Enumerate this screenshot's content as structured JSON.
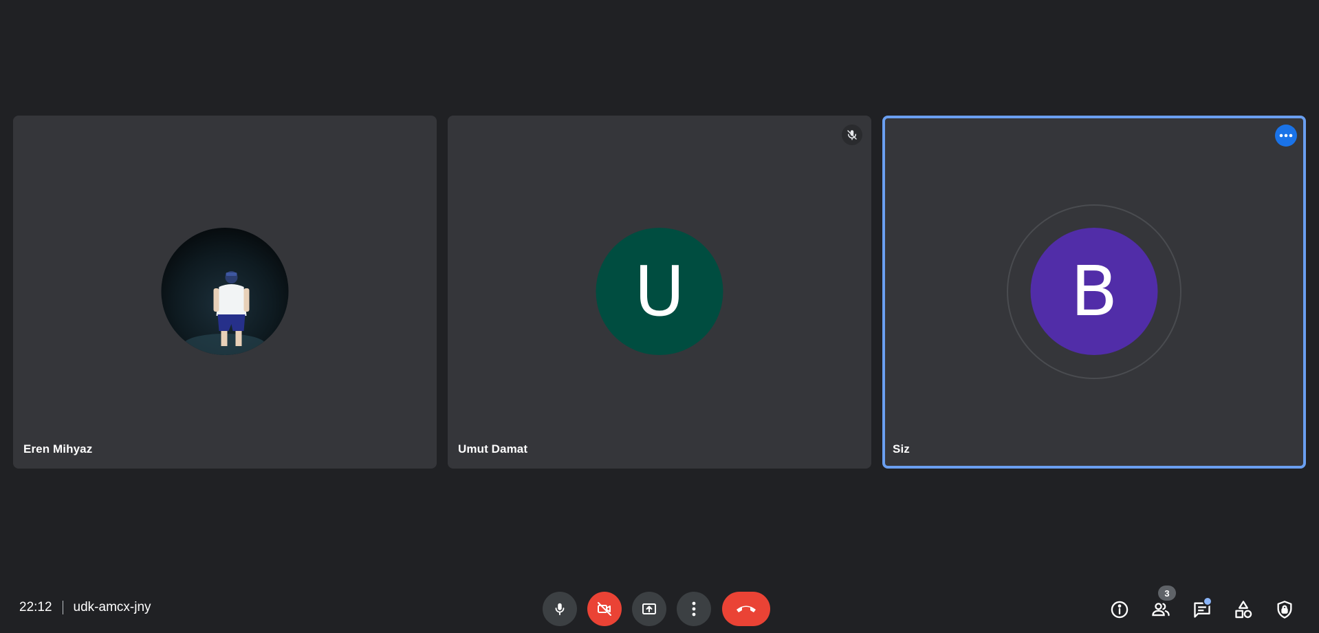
{
  "meeting": {
    "time": "22:12",
    "code": "udk-amcx-jny"
  },
  "participants": [
    {
      "name": "Eren Mihyaz",
      "avatar_type": "photo",
      "muted": false
    },
    {
      "name": "Umut Damat",
      "avatar_type": "initial",
      "initial": "U",
      "avatar_color": "#004d40",
      "muted": true
    },
    {
      "name": "Siz",
      "avatar_type": "initial",
      "initial": "B",
      "avatar_color": "#512da8",
      "muted": false,
      "active_speaker": true
    }
  ],
  "controls": {
    "center": [
      "mic-icon",
      "camera-off-icon",
      "present-icon",
      "more-vert-icon",
      "hangup-icon"
    ],
    "right": [
      "info-icon",
      "people-icon",
      "chat-icon",
      "activities-icon",
      "host-controls-icon"
    ]
  },
  "people_count": "3",
  "colors": {
    "background": "#202124",
    "tile": "#35363a",
    "danger": "#ea4335",
    "accent": "#1a73e8",
    "highlight_border": "#6a9ff0"
  }
}
